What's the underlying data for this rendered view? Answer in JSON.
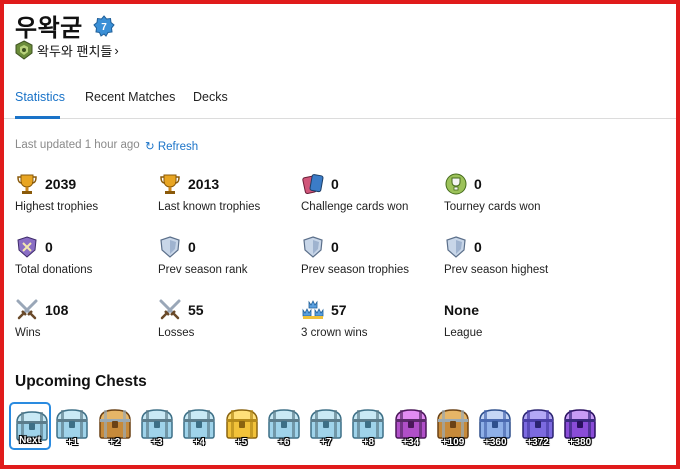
{
  "player": {
    "name": "우왁굳",
    "level": "7"
  },
  "clan": {
    "name": "왁두와 팬치들",
    "chevron": "›"
  },
  "tabs": [
    {
      "label": "Statistics",
      "active": true
    },
    {
      "label": "Recent Matches",
      "active": false
    },
    {
      "label": "Decks",
      "active": false
    }
  ],
  "status": {
    "updated": "Last updated 1 hour ago",
    "refresh": "Refresh"
  },
  "stats": [
    {
      "icon": "trophy-icon",
      "value": "2039",
      "label": "Highest trophies"
    },
    {
      "icon": "trophy-icon",
      "value": "2013",
      "label": "Last known trophies"
    },
    {
      "icon": "cards-icon",
      "value": "0",
      "label": "Challenge cards won"
    },
    {
      "icon": "tourney-icon",
      "value": "0",
      "label": "Tourney cards won"
    },
    {
      "icon": "donation-icon",
      "value": "0",
      "label": "Total donations"
    },
    {
      "icon": "shield-icon",
      "value": "0",
      "label": "Prev season rank"
    },
    {
      "icon": "shield-icon",
      "value": "0",
      "label": "Prev season trophies"
    },
    {
      "icon": "shield-icon",
      "value": "0",
      "label": "Prev season highest"
    },
    {
      "icon": "swords-icon",
      "value": "108",
      "label": "Wins"
    },
    {
      "icon": "swords-icon",
      "value": "55",
      "label": "Losses"
    },
    {
      "icon": "crowns-icon",
      "value": "57",
      "label": "3 crown wins"
    },
    {
      "icon": "",
      "value": "None",
      "label": "League"
    }
  ],
  "chests_title": "Upcoming Chests",
  "chests": [
    {
      "type": "silver",
      "label": "Next"
    },
    {
      "type": "silver",
      "label": "+1"
    },
    {
      "type": "wooden-gold",
      "label": "+2"
    },
    {
      "type": "silver",
      "label": "+3"
    },
    {
      "type": "silver",
      "label": "+4"
    },
    {
      "type": "golden",
      "label": "+5"
    },
    {
      "type": "silver",
      "label": "+6"
    },
    {
      "type": "silver",
      "label": "+7"
    },
    {
      "type": "silver",
      "label": "+8"
    },
    {
      "type": "magical",
      "label": "+34"
    },
    {
      "type": "wooden-gold",
      "label": "+109"
    },
    {
      "type": "giant",
      "label": "+360"
    },
    {
      "type": "epic",
      "label": "+372"
    },
    {
      "type": "super-magical",
      "label": "+380"
    }
  ],
  "colors": {
    "accent": "#1a73c8",
    "frame": "#e01b1b"
  }
}
